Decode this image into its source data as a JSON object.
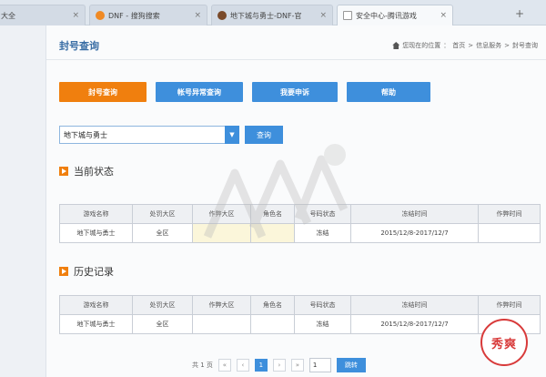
{
  "browser": {
    "tabs": [
      {
        "label": "大全",
        "active": false
      },
      {
        "label": "DNF - 搜狗搜索",
        "active": false
      },
      {
        "label": "地下城与勇士-DNF-官",
        "active": false
      },
      {
        "label": "安全中心-腾讯游戏",
        "active": true
      }
    ],
    "close_glyph": "×",
    "new_tab_glyph": "+"
  },
  "page": {
    "title": "封号查询",
    "breadcrumb": [
      "您现在的位置",
      "首页",
      "信息服务",
      "封号查询"
    ],
    "breadcrumb_sep": ">",
    "breadcrumb_colon": "："
  },
  "tabs": [
    {
      "label": "封号查询",
      "color": "#f07f0e"
    },
    {
      "label": "帐号异常查询",
      "color": "#3e8fdc"
    },
    {
      "label": "我要申诉",
      "color": "#3e8fdc"
    },
    {
      "label": "帮助",
      "color": "#3e8fdc"
    }
  ],
  "search": {
    "selected_game": "地下城与勇士",
    "arrow": "▼",
    "button_label": "查询"
  },
  "current_section": {
    "heading": "当前状态",
    "columns": [
      "游戏名称",
      "处罚大区",
      "作弊大区",
      "角色名",
      "号码状态",
      "冻结时间",
      "作弊时间"
    ],
    "row": [
      "地下城与勇士",
      "全区",
      "",
      "",
      "冻结",
      "2015/12/8-2017/12/7",
      ""
    ]
  },
  "history_section": {
    "heading": "历史记录",
    "columns": [
      "游戏名称",
      "处罚大区",
      "作弊大区",
      "角色名",
      "号码状态",
      "冻结时间",
      "作弊时间"
    ],
    "row": [
      "地下城与勇士",
      "全区",
      "",
      "",
      "冻结",
      "2015/12/8-2017/12/7",
      ""
    ]
  },
  "pagination": {
    "total": "共 1 页",
    "first": "«",
    "prev": "‹",
    "current": "1",
    "next": "›",
    "last": "»",
    "input_value": "1",
    "go_label": "跳转"
  },
  "stamp_text": "秀爽",
  "colors": {
    "accent_orange": "#f07f0e",
    "accent_blue": "#3e8fdc",
    "stamp_red": "#d83a3a"
  }
}
